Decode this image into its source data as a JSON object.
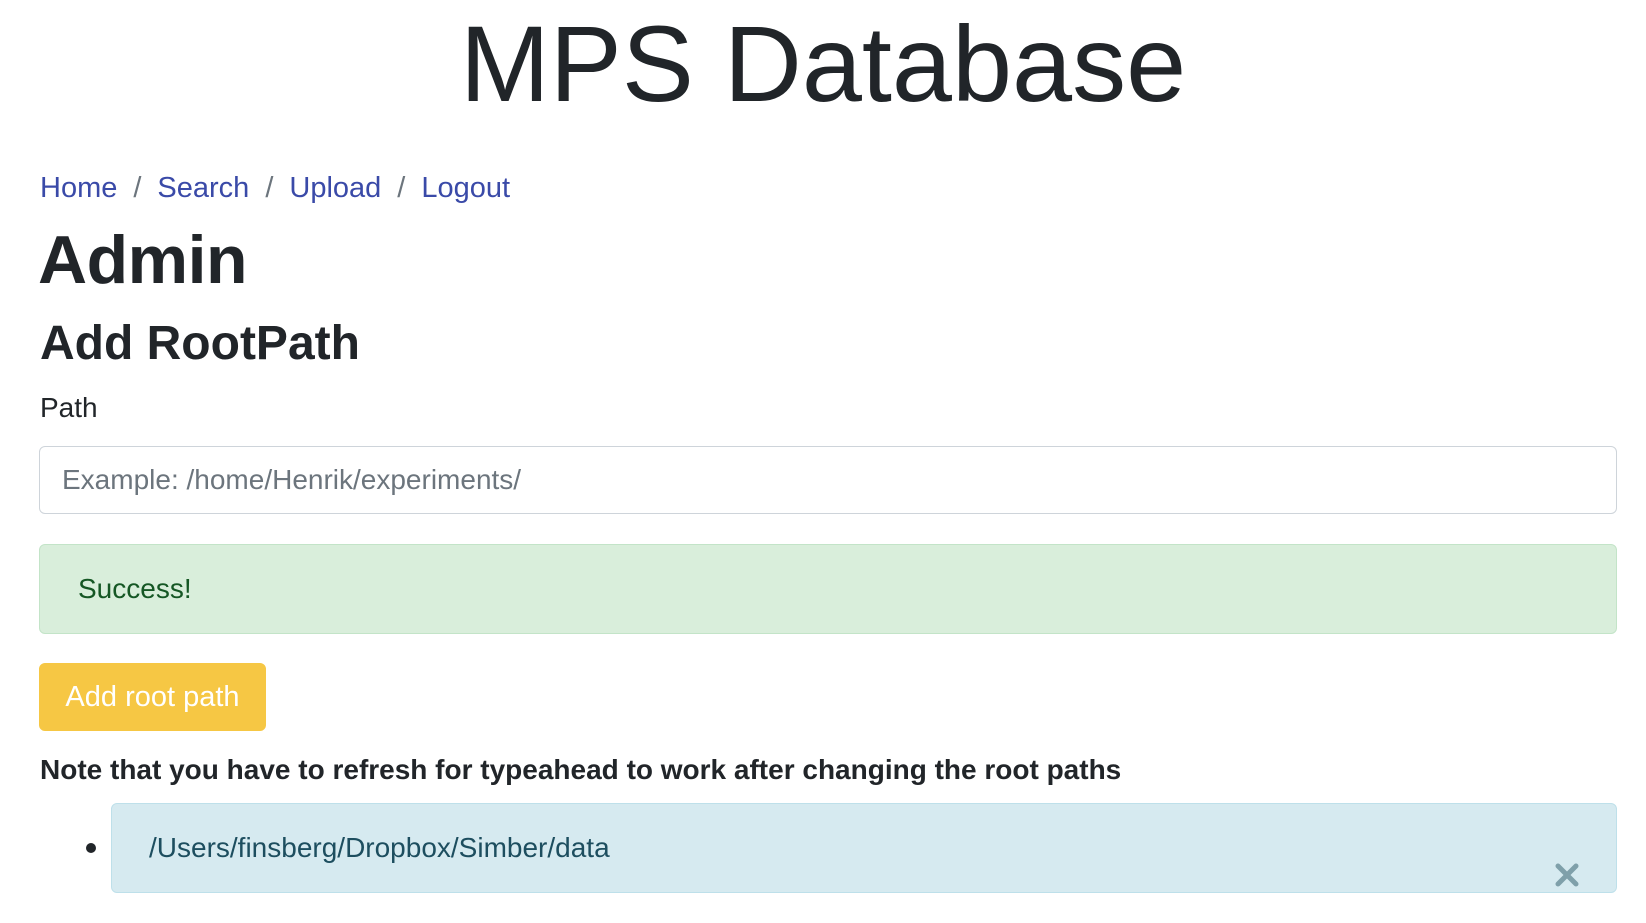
{
  "header": {
    "site_title": "MPS Database"
  },
  "breadcrumb": {
    "items": [
      {
        "label": "Home"
      },
      {
        "label": "Search"
      },
      {
        "label": "Upload"
      },
      {
        "label": "Logout"
      }
    ],
    "separator": "/"
  },
  "page": {
    "title": "Admin",
    "section_title": "Add RootPath"
  },
  "form": {
    "path_label": "Path",
    "path_value": "",
    "path_placeholder": "Example: /home/Henrik/experiments/",
    "success_message": "Success!",
    "submit_label": "Add root path"
  },
  "note": "Note that you have to refresh for typeahead to work after changing the root paths",
  "root_paths": [
    {
      "path": "/Users/finsberg/Dropbox/Simber/data",
      "remove_icon": "close-icon"
    }
  ],
  "colors": {
    "link": "#3a4aa8",
    "success_bg": "#d9eedb",
    "success_text": "#155724",
    "warning_button": "#f6c744",
    "info_bg": "#d6eaf0",
    "info_text": "#1d4e5f"
  }
}
